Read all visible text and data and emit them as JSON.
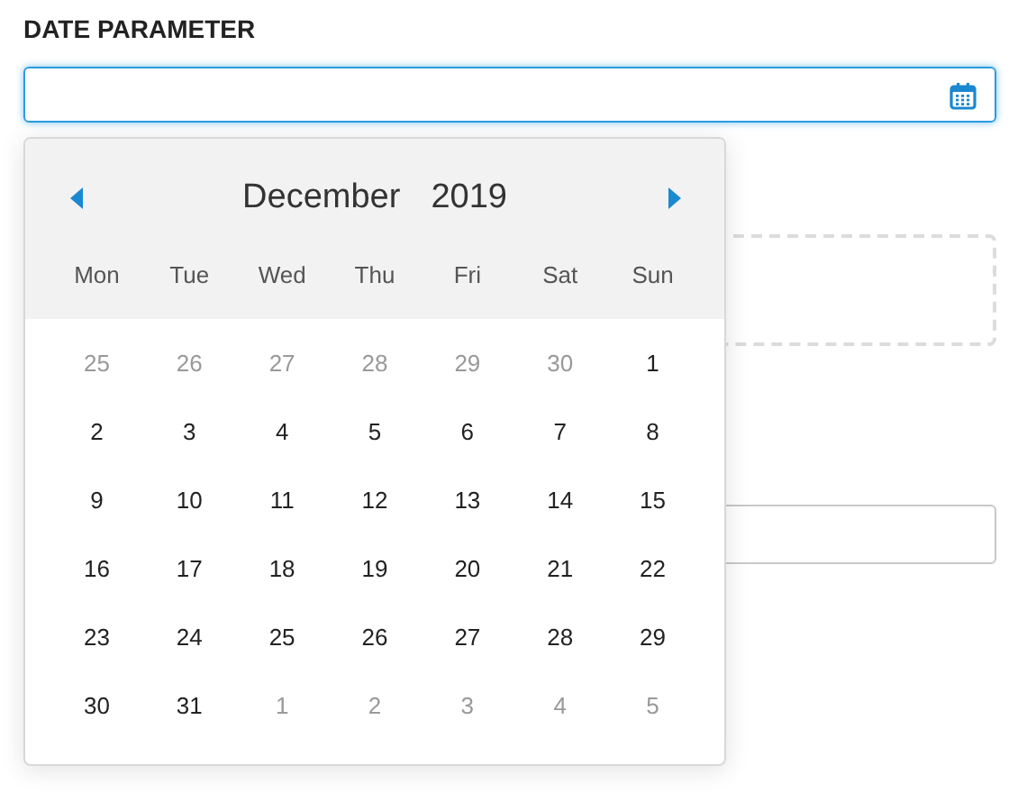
{
  "label": "DATE PARAMETER",
  "calendar": {
    "month": "December",
    "year": "2019",
    "weekdays": [
      "Mon",
      "Tue",
      "Wed",
      "Thu",
      "Fri",
      "Sat",
      "Sun"
    ],
    "weeks": [
      [
        {
          "label": "25",
          "outside": true
        },
        {
          "label": "26",
          "outside": true
        },
        {
          "label": "27",
          "outside": true
        },
        {
          "label": "28",
          "outside": true
        },
        {
          "label": "29",
          "outside": true
        },
        {
          "label": "30",
          "outside": true
        },
        {
          "label": "1",
          "outside": false
        }
      ],
      [
        {
          "label": "2",
          "outside": false
        },
        {
          "label": "3",
          "outside": false
        },
        {
          "label": "4",
          "outside": false
        },
        {
          "label": "5",
          "outside": false
        },
        {
          "label": "6",
          "outside": false
        },
        {
          "label": "7",
          "outside": false
        },
        {
          "label": "8",
          "outside": false
        }
      ],
      [
        {
          "label": "9",
          "outside": false
        },
        {
          "label": "10",
          "outside": false
        },
        {
          "label": "11",
          "outside": false
        },
        {
          "label": "12",
          "outside": false
        },
        {
          "label": "13",
          "outside": false
        },
        {
          "label": "14",
          "outside": false
        },
        {
          "label": "15",
          "outside": false
        }
      ],
      [
        {
          "label": "16",
          "outside": false
        },
        {
          "label": "17",
          "outside": false
        },
        {
          "label": "18",
          "outside": false
        },
        {
          "label": "19",
          "outside": false
        },
        {
          "label": "20",
          "outside": false
        },
        {
          "label": "21",
          "outside": false
        },
        {
          "label": "22",
          "outside": false
        }
      ],
      [
        {
          "label": "23",
          "outside": false
        },
        {
          "label": "24",
          "outside": false
        },
        {
          "label": "25",
          "outside": false
        },
        {
          "label": "26",
          "outside": false
        },
        {
          "label": "27",
          "outside": false
        },
        {
          "label": "28",
          "outside": false
        },
        {
          "label": "29",
          "outside": false
        }
      ],
      [
        {
          "label": "30",
          "outside": false
        },
        {
          "label": "31",
          "outside": false
        },
        {
          "label": "1",
          "outside": true
        },
        {
          "label": "2",
          "outside": true
        },
        {
          "label": "3",
          "outside": true
        },
        {
          "label": "4",
          "outside": true
        },
        {
          "label": "5",
          "outside": true
        }
      ]
    ]
  }
}
